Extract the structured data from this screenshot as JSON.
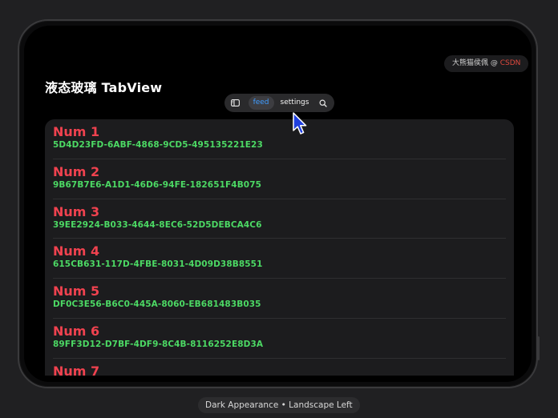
{
  "watermark": {
    "prefix": "大熊猫侯佩 @ ",
    "brand": "CSDN"
  },
  "page": {
    "title": "液态玻璃 TabView"
  },
  "tabbar": {
    "sidebar_icon": "sidebar-icon",
    "tabs": [
      {
        "label": "feed",
        "active": true
      },
      {
        "label": "settings",
        "active": false
      }
    ],
    "search_icon": "search-icon"
  },
  "list": {
    "items": [
      {
        "title": "Num 1",
        "uuid": "5D4D23FD-6ABF-4868-9CD5-495135221E23"
      },
      {
        "title": "Num 2",
        "uuid": "9B67B7E6-A1D1-46D6-94FE-182651F4B075"
      },
      {
        "title": "Num 3",
        "uuid": "39EE2924-B033-4644-8EC6-52D5DEBCA4C6"
      },
      {
        "title": "Num 4",
        "uuid": "615CB631-117D-4FBE-8031-4D09D38B8551"
      },
      {
        "title": "Num 5",
        "uuid": "DF0C3E56-B6C0-445A-8060-EB681483B035"
      },
      {
        "title": "Num 6",
        "uuid": "89FF3D12-D7BF-4DF9-8C4B-8116252E8D3A"
      },
      {
        "title": "Num 7",
        "uuid": ""
      }
    ]
  },
  "colors": {
    "title_red": "#f0424f",
    "uuid_green": "#4cd964",
    "active_tab_blue": "#3f9cff"
  },
  "caption": "Dark Appearance • Landscape Left"
}
